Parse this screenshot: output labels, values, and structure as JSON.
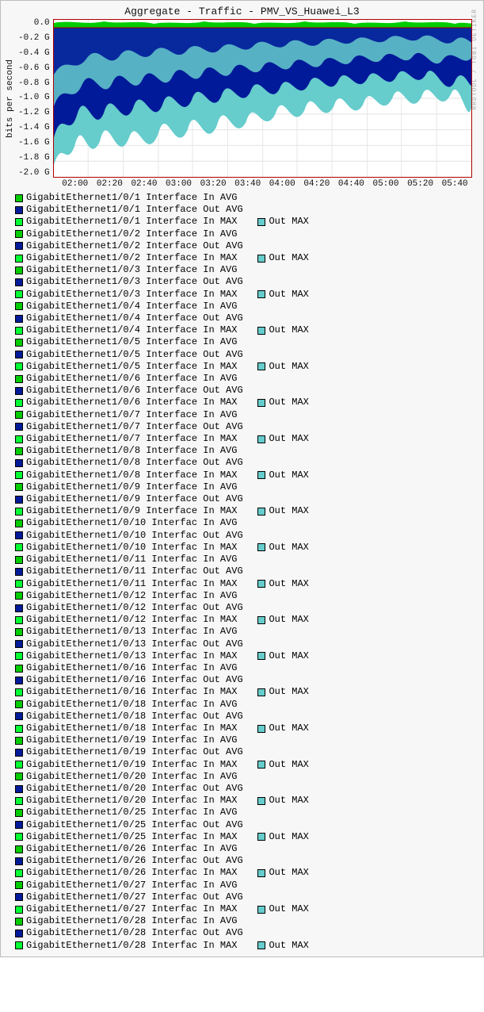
{
  "credit": "RRDTOOL / TOBI OETIKER",
  "chart_data": {
    "type": "area",
    "title": "Aggregate - Traffic - PMV_VS_Huawei_L3",
    "ylabel": "bits per second",
    "xlabel": "",
    "ylim": [
      -2.0,
      0.1
    ],
    "y_ticks": [
      "0.0",
      "-0.2 G",
      "-0.4 G",
      "-0.6 G",
      "-0.8 G",
      "-1.0 G",
      "-1.2 G",
      "-1.4 G",
      "-1.6 G",
      "-1.8 G",
      "-2.0 G"
    ],
    "x_ticks": [
      "02:00",
      "02:20",
      "02:40",
      "03:00",
      "03:20",
      "03:40",
      "04:00",
      "04:20",
      "04:40",
      "05:00",
      "05:20",
      "05:40"
    ],
    "note": "Stacked aggregate inbound (positive, small green band near 0) and outbound (negative, dominant teal/navy) interface traffic across ~22 GigabitEthernet1/0/x ports. Outbound aggregate oscillates roughly between -0.4 G and -1.8 G bits/s with peaks near -2.0 G early in the window and shallower troughs (~-0.8 G to -1.2 G) later. Per-series values not individually resolvable from raster.",
    "series_colors": {
      "in_avg": "#00cc00",
      "out_avg": "#001a99",
      "in_max": "#00ff33",
      "out_max": "#66cccc"
    }
  },
  "legend": {
    "out_max_label": "Out MAX",
    "ports": [
      {
        "n": "1",
        "s": "Interface"
      },
      {
        "n": "2",
        "s": "Interface"
      },
      {
        "n": "3",
        "s": "Interface"
      },
      {
        "n": "4",
        "s": "Interface"
      },
      {
        "n": "5",
        "s": "Interface"
      },
      {
        "n": "6",
        "s": "Interface"
      },
      {
        "n": "7",
        "s": "Interface"
      },
      {
        "n": "8",
        "s": "Interface"
      },
      {
        "n": "9",
        "s": "Interface"
      },
      {
        "n": "10",
        "s": "Interfac"
      },
      {
        "n": "11",
        "s": "Interfac"
      },
      {
        "n": "12",
        "s": "Interfac"
      },
      {
        "n": "13",
        "s": "Interfac"
      },
      {
        "n": "16",
        "s": "Interfac"
      },
      {
        "n": "18",
        "s": "Interfac"
      },
      {
        "n": "19",
        "s": "Interfac"
      },
      {
        "n": "20",
        "s": "Interfac"
      },
      {
        "n": "25",
        "s": "Interfac"
      },
      {
        "n": "26",
        "s": "Interfac"
      },
      {
        "n": "27",
        "s": "Interfac"
      },
      {
        "n": "28",
        "s": "Interfac"
      }
    ]
  }
}
